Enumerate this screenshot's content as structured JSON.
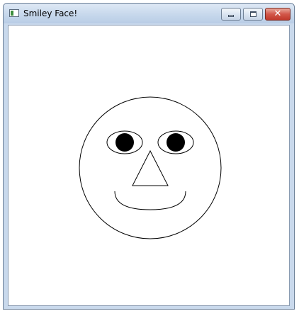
{
  "window": {
    "title": "Smiley Face!",
    "close_glyph": "✕"
  },
  "icons": {
    "app": "app-window-icon",
    "minimize": "minimize-icon",
    "maximize": "maximize-icon",
    "close": "close-icon"
  },
  "colors": {
    "stroke": "#000000",
    "pupil": "#000000",
    "canvas": "#ffffff",
    "close_button": "#c0392b"
  }
}
